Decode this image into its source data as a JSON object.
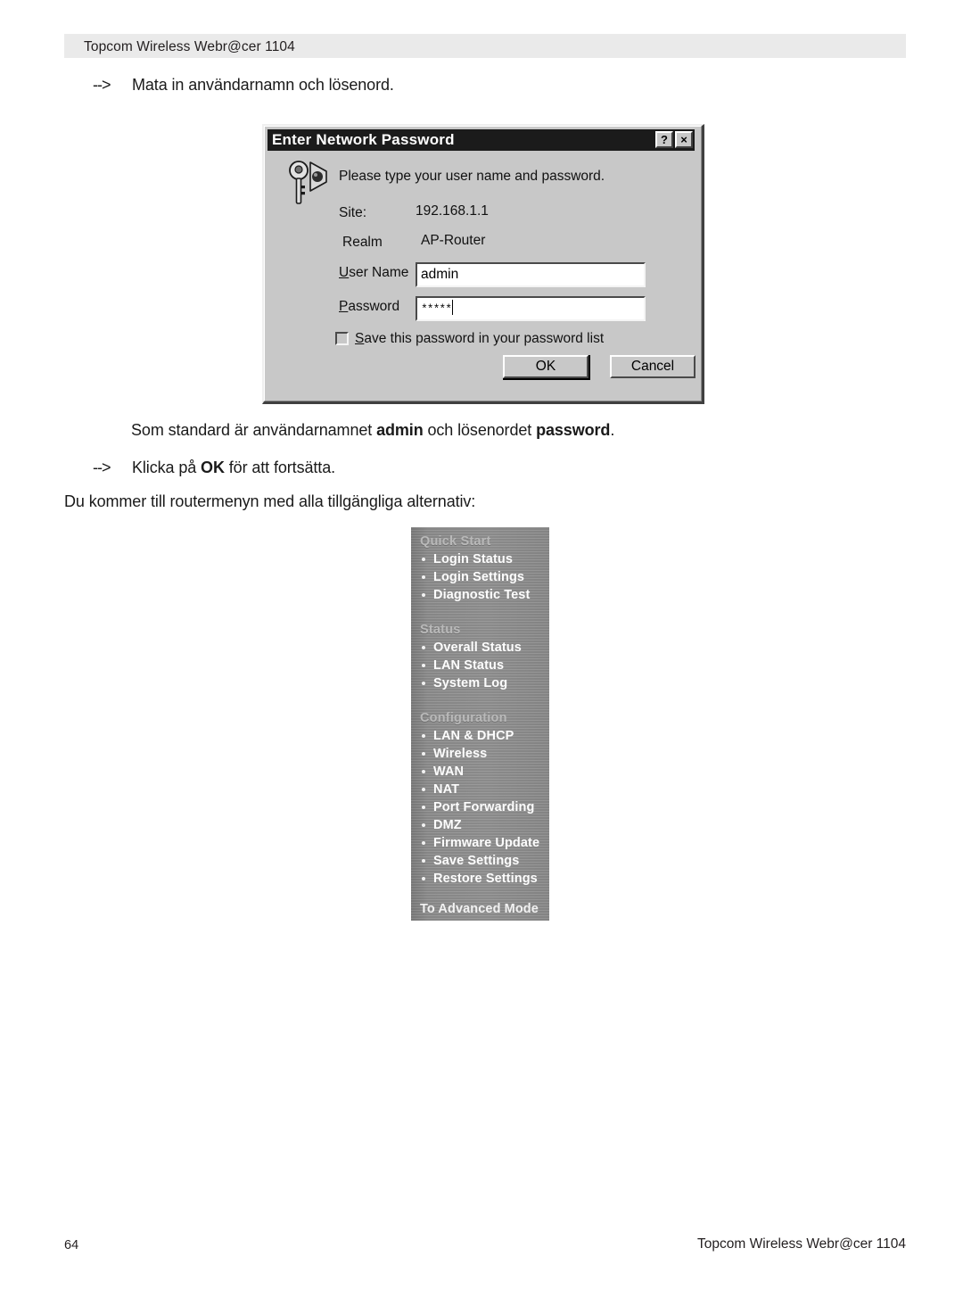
{
  "header": {
    "title": "Topcom Wireless Webr@cer 1104"
  },
  "body_text": {
    "arrow_marker": "-->",
    "line1": "Mata in användarnamn och lösenord.",
    "line2_prefix": "Som standard är användarnamnet ",
    "line2_bold1": "admin",
    "line2_mid": " och lösenordet ",
    "line2_bold2": "password",
    "line2_suffix": ".",
    "line3_prefix": "Klicka på ",
    "line3_bold": "OK",
    "line3_suffix": " för att fortsätta.",
    "line4": "Du kommer till routermenyn med alla tillgängliga alternativ:"
  },
  "dialog": {
    "title": "Enter Network Password",
    "help_button": "?",
    "close_button": "×",
    "prompt": "Please type your user name and password.",
    "site_label": "Site:",
    "site_value": "192.168.1.1",
    "realm_label": "Realm",
    "realm_value": "AP-Router",
    "username_label_accel": "U",
    "username_label_rest": "ser Name",
    "username_value": "admin",
    "password_label_accel": "P",
    "password_label_rest": "assword",
    "password_value": "*****",
    "save_checkbox_accel": "S",
    "save_checkbox_rest": "ave this password in your password list",
    "save_checkbox_checked": false,
    "ok_button": "OK",
    "cancel_button": "Cancel",
    "icon": "key-icon"
  },
  "router_menu": {
    "groups": [
      {
        "title": "Quick Start",
        "items": [
          "Login Status",
          "Login Settings",
          "Diagnostic Test"
        ]
      },
      {
        "title": "Status",
        "items": [
          "Overall Status",
          "LAN Status",
          "System Log"
        ]
      },
      {
        "title": "Configuration",
        "items": [
          "LAN & DHCP",
          "Wireless",
          "WAN",
          "NAT",
          "Port Forwarding",
          "DMZ",
          "Firmware Update",
          "Save Settings",
          "Restore Settings"
        ]
      }
    ],
    "footer_link": "To Advanced Mode"
  },
  "footer": {
    "page_number": "64",
    "title": "Topcom Wireless Webr@cer 1104"
  },
  "colors": {
    "header_band": "#eaeaea",
    "dialog_face": "#c8c8c8",
    "titlebar": "#1b1b1b",
    "menu_panel": "#8d8d8d",
    "menu_item_text": "#fdfdfd",
    "menu_group_text": "#b9b9b9"
  }
}
